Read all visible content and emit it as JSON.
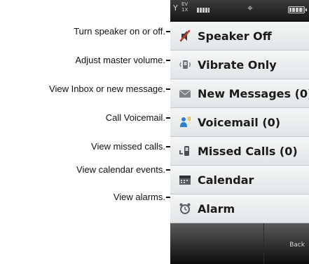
{
  "callouts": [
    "Turn speaker on or off.",
    "Adjust master volume.",
    "View Inbox or new message.",
    "Call Voicemail.",
    "View missed calls.",
    "View calendar events.",
    "View alarms."
  ],
  "status_bar": {
    "signal_glyph": "Y",
    "network_line1": "EV",
    "network_line2": "1X"
  },
  "menu": [
    {
      "icon": "speaker-off-icon",
      "label": "Speaker Off"
    },
    {
      "icon": "vibrate-icon",
      "label": "Vibrate Only"
    },
    {
      "icon": "envelope-icon",
      "label": "New Messages (0)"
    },
    {
      "icon": "voicemail-icon",
      "label": "Voicemail (0)"
    },
    {
      "icon": "missed-call-icon",
      "label": "Missed Calls (0)"
    },
    {
      "icon": "calendar-icon",
      "label": "Calendar"
    },
    {
      "icon": "alarm-clock-icon",
      "label": "Alarm"
    }
  ],
  "softkeys": {
    "right": "Back"
  },
  "colors": {
    "menu_bg": "#e9ecee",
    "status_bar": "#141414",
    "speaker_red": "#c0392b",
    "voicemail_blue": "#2a7fd0"
  }
}
